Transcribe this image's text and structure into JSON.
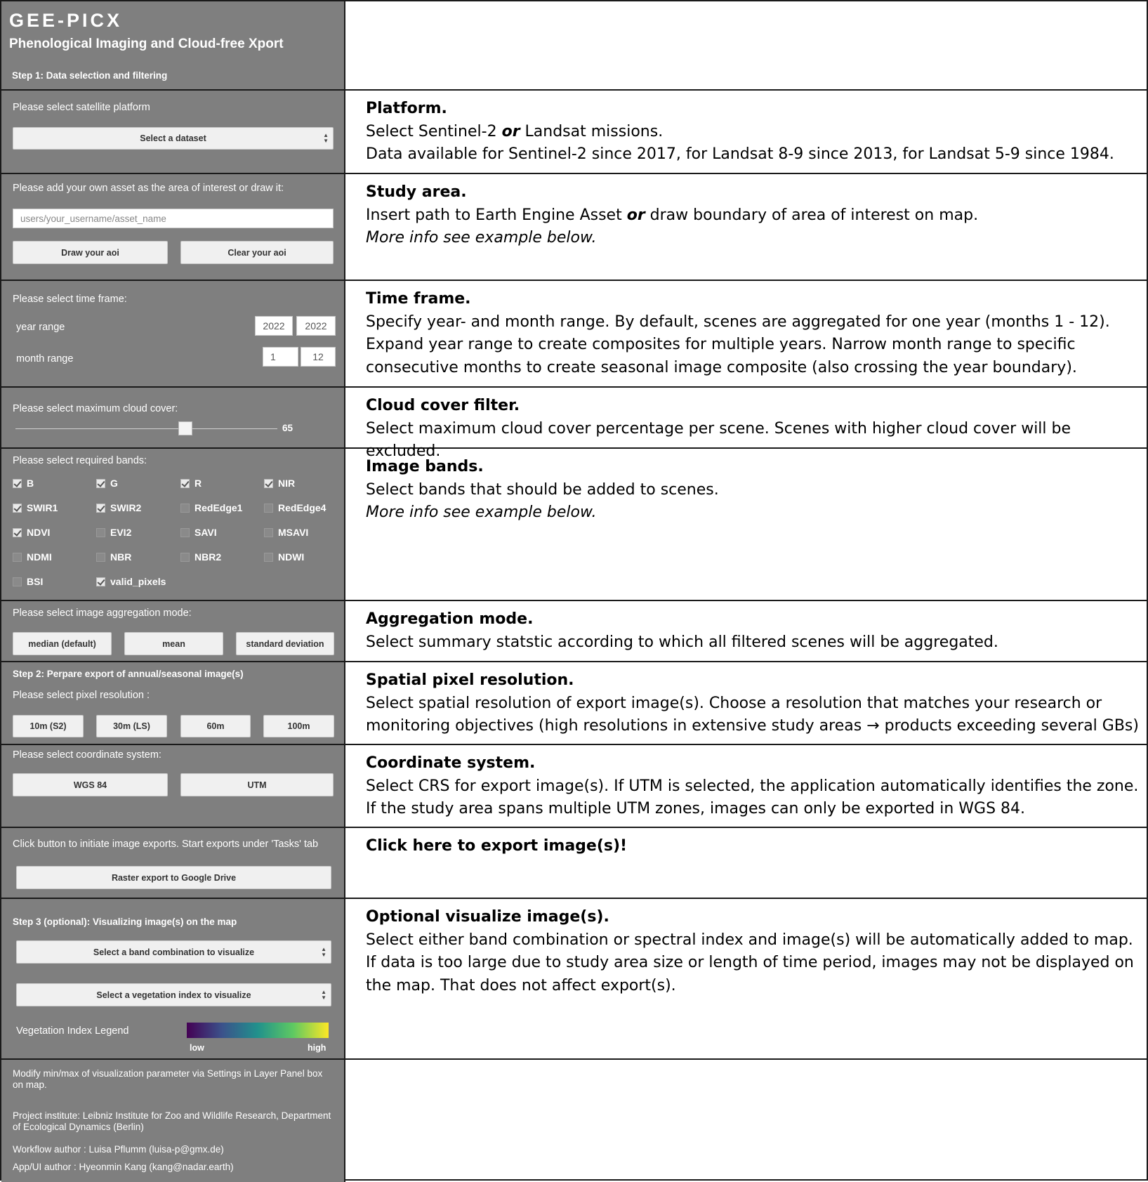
{
  "header": {
    "app_name": "GEE-PICX",
    "subtitle": "Phenological Imaging and Cloud-free Xport",
    "step1": "Step 1: Data selection and filtering"
  },
  "platform": {
    "label": "Please select satellite platform",
    "select_value": "Select a dataset",
    "help_title": "Platform.",
    "help_line1_a": "Select Sentinel-2 ",
    "help_line1_or": "or",
    "help_line1_b": " Landsat missions.",
    "help_line2": "Data available for Sentinel-2 since 2017, for Landsat 8-9 since 2013, for Landsat 5-9 since 1984."
  },
  "study_area": {
    "label": "Please add your own asset as the area of interest or draw it:",
    "asset_placeholder": "users/your_username/asset_name",
    "draw_button": "Draw your aoi",
    "clear_button": "Clear your aoi",
    "help_title": "Study area.",
    "help_line1_a": "Insert path to Earth Engine Asset ",
    "help_line1_or": "or",
    "help_line1_b": " draw boundary of area of interest on map.",
    "help_line2": "More info see example below."
  },
  "time_frame": {
    "label": "Please select time frame:",
    "year_label": "year range",
    "year_start": "2022",
    "year_end": "2022",
    "month_label": "month range",
    "month_start": "1",
    "month_end": "12",
    "help_title": "Time frame.",
    "help_line1": "Specify year- and month range. By default, scenes are aggregated for one year (months 1 - 12).",
    "help_line2": "Expand year range to create composites for multiple years. Narrow month range to specific",
    "help_line3": "consecutive months to create seasonal image composite (also crossing the year boundary)."
  },
  "cloud": {
    "label": "Please select maximum cloud cover:",
    "value": 65,
    "value_text": "65",
    "help_title": "Cloud cover filter.",
    "help_line1": "Select maximum cloud cover percentage per scene. Scenes with higher cloud cover will be excluded."
  },
  "bands": {
    "label": "Please select required bands:",
    "items": [
      {
        "name": "B",
        "checked": true
      },
      {
        "name": "G",
        "checked": true
      },
      {
        "name": "R",
        "checked": true
      },
      {
        "name": "NIR",
        "checked": true
      },
      {
        "name": "SWIR1",
        "checked": true
      },
      {
        "name": "SWIR2",
        "checked": true
      },
      {
        "name": "RedEdge1",
        "checked": false
      },
      {
        "name": "RedEdge4",
        "checked": false
      },
      {
        "name": "NDVI",
        "checked": true
      },
      {
        "name": "EVI2",
        "checked": false
      },
      {
        "name": "SAVI",
        "checked": false
      },
      {
        "name": "MSAVI",
        "checked": false
      },
      {
        "name": "NDMI",
        "checked": false
      },
      {
        "name": "NBR",
        "checked": false
      },
      {
        "name": "NBR2",
        "checked": false
      },
      {
        "name": "NDWI",
        "checked": false
      },
      {
        "name": "BSI",
        "checked": false
      },
      {
        "name": "valid_pixels",
        "checked": true
      }
    ],
    "help_title": "Image bands.",
    "help_line1": "Select bands that should be added to scenes.",
    "help_line2": "More info see example below."
  },
  "aggregation": {
    "label": "Please select image aggregation mode:",
    "buttons": [
      "median (default)",
      "mean",
      "standard deviation"
    ],
    "help_title": "Aggregation mode.",
    "help_line1": "Select summary statstic according to which all filtered scenes will be aggregated."
  },
  "resolution": {
    "step2": "Step 2: Perpare export of annual/seasonal image(s)",
    "label": "Please select pixel resolution :",
    "buttons": [
      "10m (S2)",
      "30m (LS)",
      "60m",
      "100m"
    ],
    "help_title": "Spatial pixel resolution.",
    "help_line1": "Select spatial resolution of export image(s). Choose a resolution that matches your research or",
    "help_line2": "monitoring objectives (high resolutions in extensive study areas → products exceeding several GBs)"
  },
  "crs": {
    "label": "Please select coordinate system:",
    "buttons": [
      "WGS 84",
      "UTM"
    ],
    "help_title": "Coordinate system.",
    "help_line1": "Select CRS for export image(s). If UTM is selected, the application automatically identifies the zone.",
    "help_line2": "If the study area spans multiple UTM zones, images can only be exported in WGS 84."
  },
  "export": {
    "label": "Click button to initiate image exports. Start exports under 'Tasks' tab",
    "button": "Raster export to Google Drive",
    "help_title": "Click here to export image(s)!"
  },
  "visualize": {
    "step3": "Step 3 (optional): Visualizing image(s) on the map",
    "band_select": "Select a band combination to visualize",
    "index_select": "Select a vegetation index to visualize",
    "legend_label": "Vegetation Index Legend",
    "legend_low": "low",
    "legend_high": "high",
    "help_title": "Optional visualize image(s).",
    "help_line1": "Select either band combination or spectral index and image(s) will be automatically added to map.",
    "help_line2": "If data is too large due to study area size or length of time period, images may not be displayed on",
    "help_line3": "the map. That does not affect export(s)."
  },
  "footer": {
    "line1": "Modify min/max of visualization parameter via Settings in Layer Panel box on map.",
    "line2": "Project institute: Leibniz Institute for Zoo and Wildlife Research, Department of Ecological Dynamics (Berlin)",
    "line3": "Workflow author : Luisa Pflumm (luisa-p@gmx.de)",
    "line4": "App/UI author : Hyeonmin Kang (kang@nadar.earth)"
  }
}
